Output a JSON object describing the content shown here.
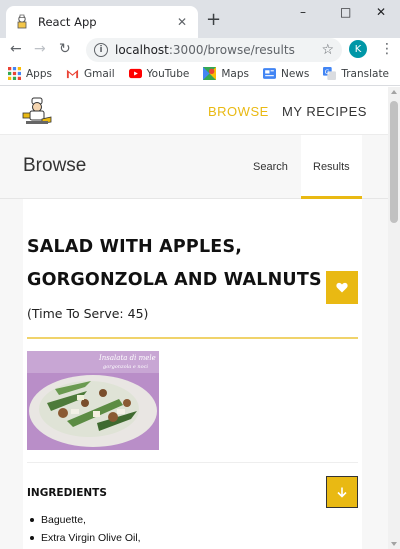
{
  "browser": {
    "tab_title": "React App",
    "new_tab_symbol": "+",
    "url_host": "localhost",
    "url_path": ":3000/browse/results",
    "profile_initial": "K",
    "window_controls": [
      "–",
      "□",
      "✕"
    ]
  },
  "bookmarks": [
    {
      "label": "Apps",
      "icon": "apps-grid-icon"
    },
    {
      "label": "Gmail",
      "icon": "gmail-icon"
    },
    {
      "label": "YouTube",
      "icon": "youtube-icon"
    },
    {
      "label": "Maps",
      "icon": "maps-icon"
    },
    {
      "label": "News",
      "icon": "news-icon"
    },
    {
      "label": "Translate",
      "icon": "translate-icon"
    }
  ],
  "header": {
    "nav_browse": "BROWSE",
    "nav_recipes": "MY RECIPES",
    "accent_color": "#e9b913"
  },
  "browse": {
    "title": "Browse",
    "tab_search": "Search",
    "tab_results": "Results"
  },
  "recipe": {
    "title": "SALAD WITH APPLES, GORGONZOLA AND WALNUTS",
    "serve_text": "(Time To Serve: 45)",
    "image_caption": "Insalata di mele gorgonzola e noci",
    "ingredients_label": "INGREDIENTS",
    "ingredients": [
      "Baguette,",
      "Extra Virgin Olive Oil,"
    ]
  }
}
